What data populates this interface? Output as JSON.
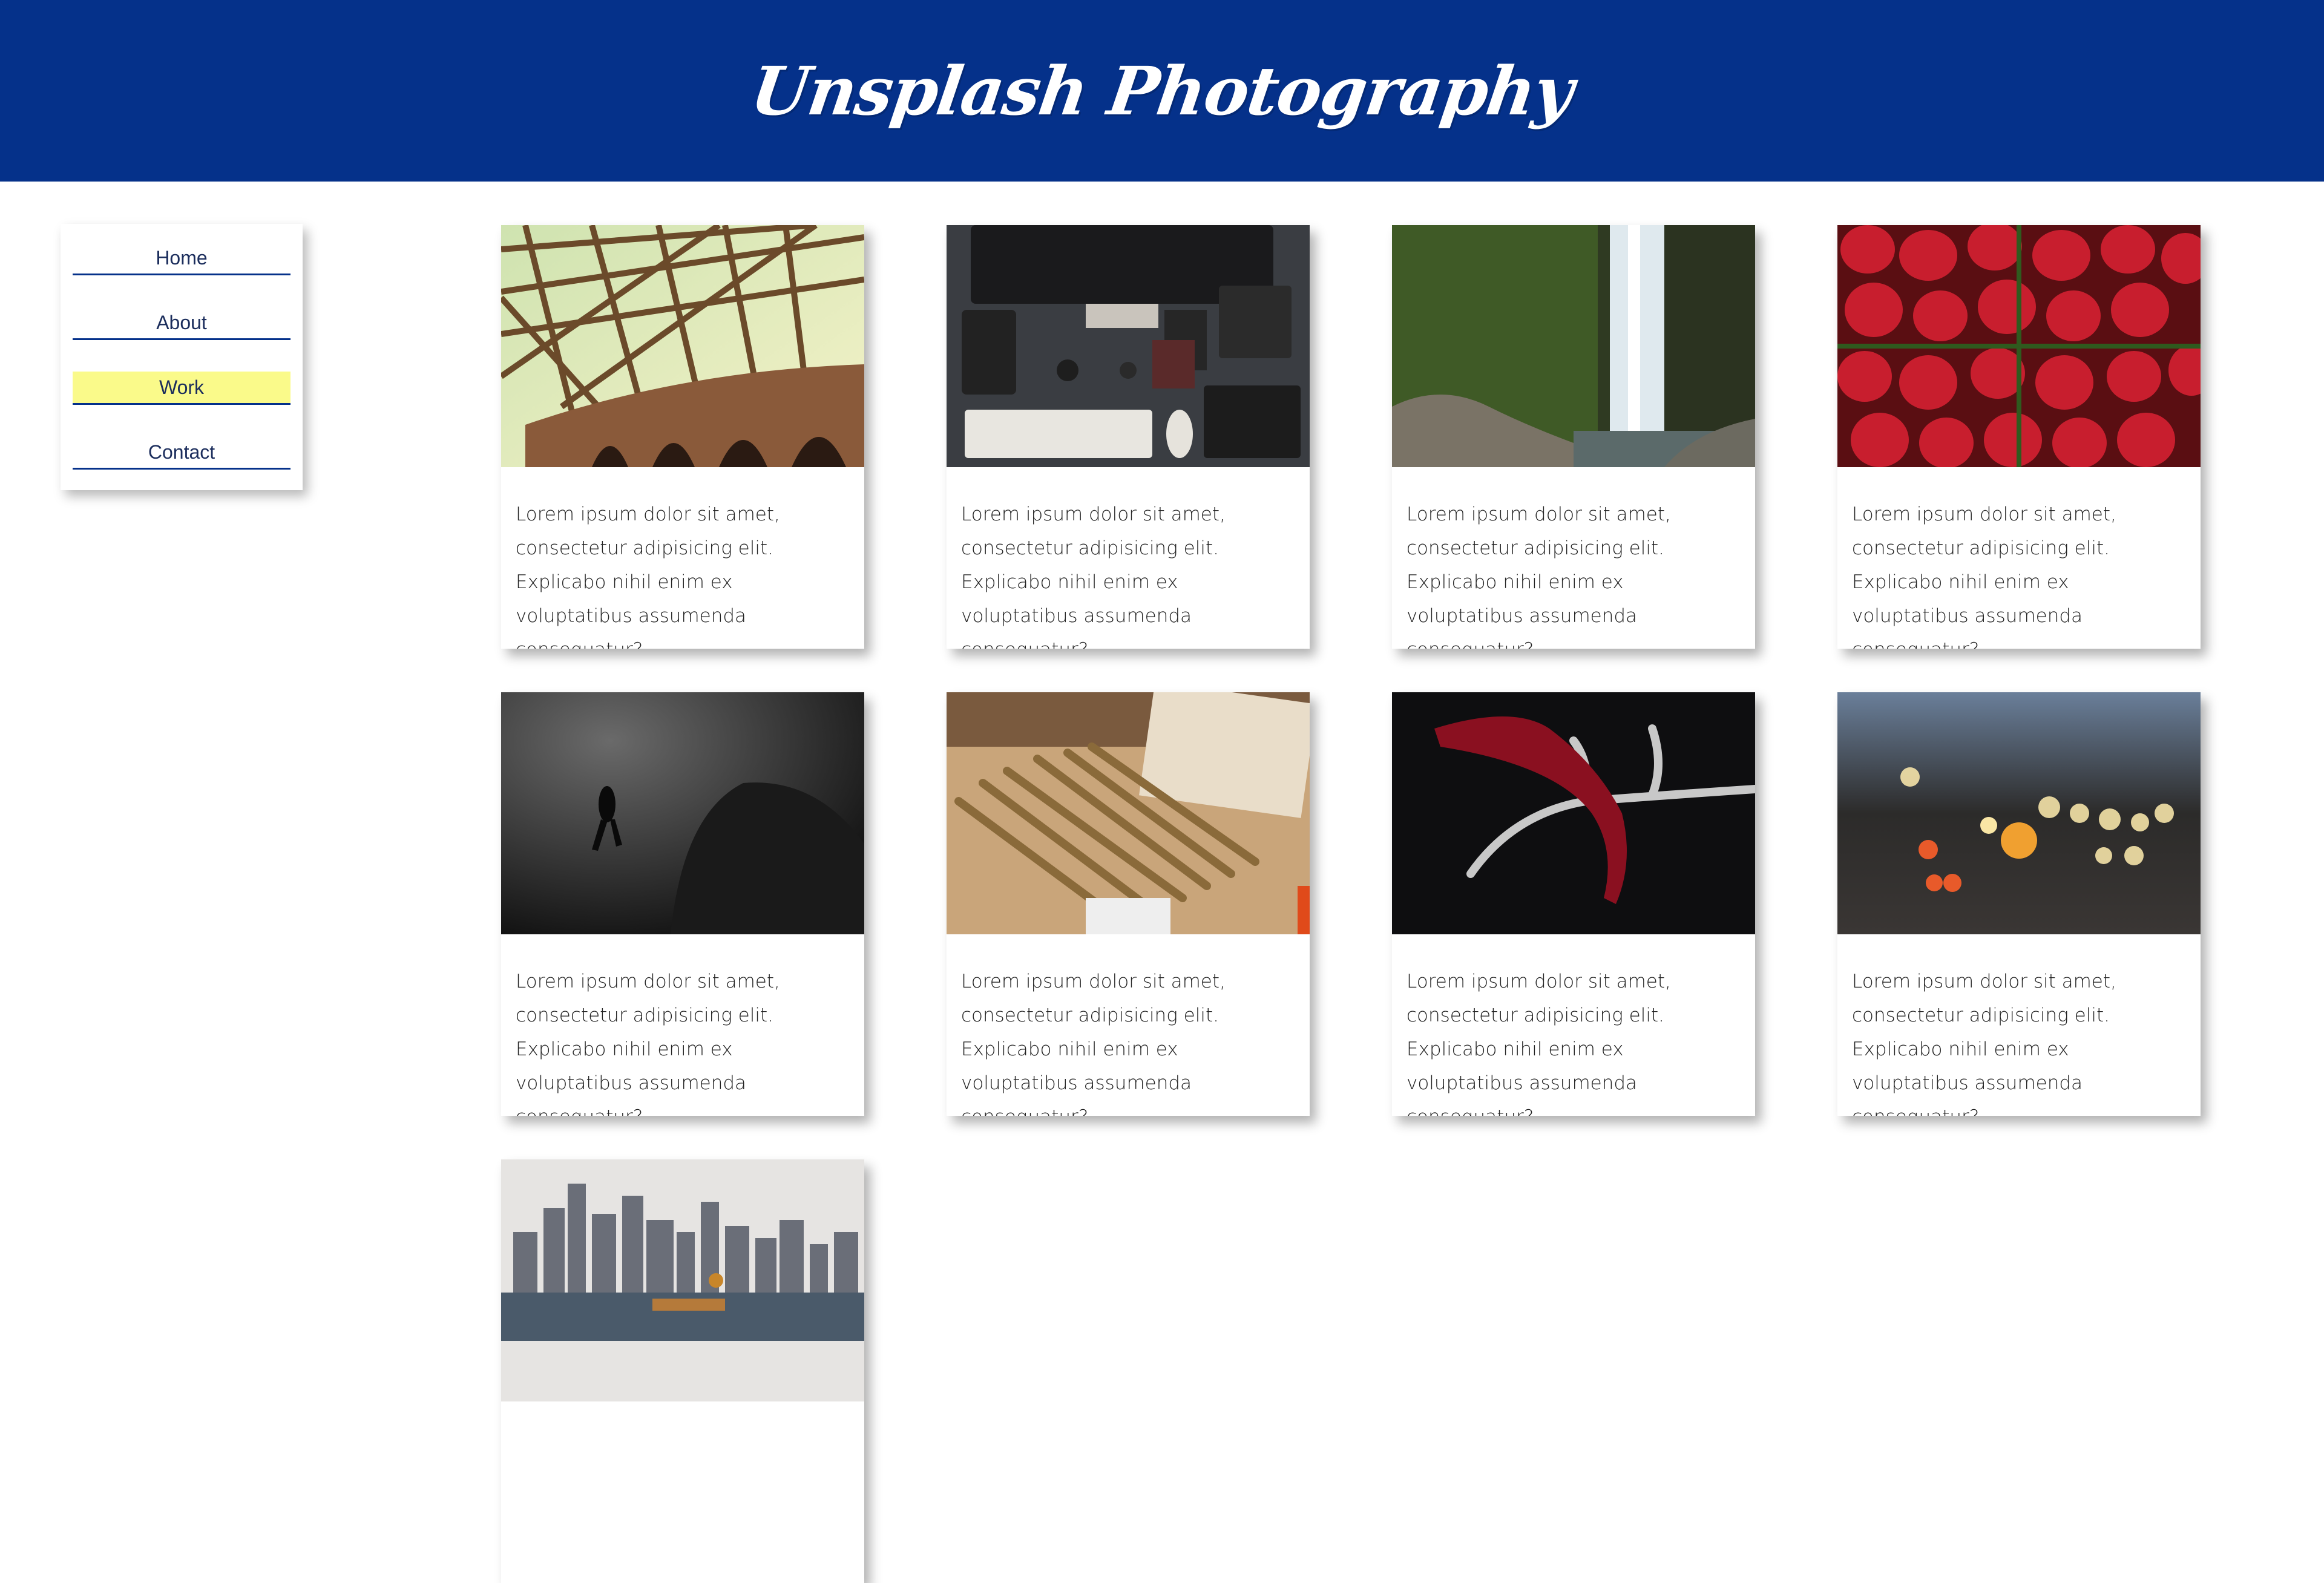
{
  "header": {
    "title": "Unsplash Photography",
    "bg_color": "#05318a"
  },
  "nav": {
    "items": [
      {
        "label": "Home",
        "active": false
      },
      {
        "label": "About",
        "active": false
      },
      {
        "label": "Work",
        "active": true
      },
      {
        "label": "Contact",
        "active": false
      }
    ],
    "active_highlight": "#fafa8a"
  },
  "cards": [
    {
      "image": "bridge-photo",
      "text": "Lorem ipsum dolor sit amet, consectetur adipisicing elit. Explicabo nihil enim ex voluptatibus assumenda consequatur?"
    },
    {
      "image": "desk-setup-photo",
      "text": "Lorem ipsum dolor sit amet, consectetur adipisicing elit. Explicabo nihil enim ex voluptatibus assumenda consequatur?"
    },
    {
      "image": "waterfall-photo",
      "text": "Lorem ipsum dolor sit amet, consectetur adipisicing elit. Explicabo nihil enim ex voluptatibus assumenda consequatur?"
    },
    {
      "image": "strawberries-photo",
      "text": "Lorem ipsum dolor sit amet, consectetur adipisicing elit. Explicabo nihil enim ex voluptatibus assumenda consequatur?"
    },
    {
      "image": "diver-photo",
      "text": "Lorem ipsum dolor sit amet, consectetur adipisicing elit. Explicabo nihil enim ex voluptatibus assumenda consequatur?"
    },
    {
      "image": "pencils-photo",
      "text": "Lorem ipsum dolor sit amet, consectetur adipisicing elit. Explicabo nihil enim ex voluptatibus assumenda consequatur?"
    },
    {
      "image": "antler-photo",
      "text": "Lorem ipsum dolor sit amet, consectetur adipisicing elit. Explicabo nihil enim ex voluptatibus assumenda consequatur?"
    },
    {
      "image": "bokeh-street-photo",
      "text": "Lorem ipsum dolor sit amet, consectetur adipisicing elit. Explicabo nihil enim ex voluptatibus assumenda consequatur?"
    },
    {
      "image": "city-skyline-photo",
      "text": ""
    }
  ]
}
